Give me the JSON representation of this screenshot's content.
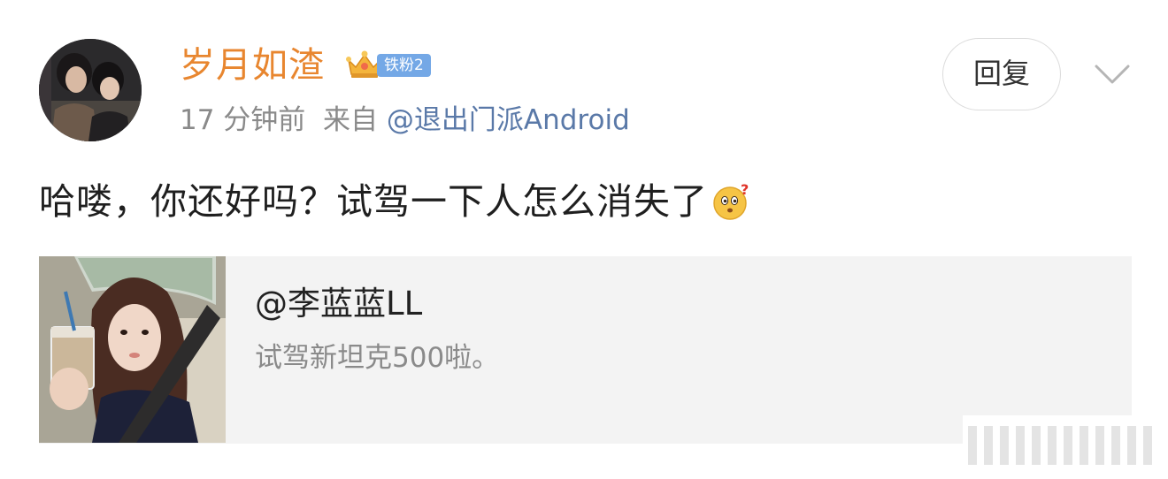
{
  "post": {
    "username": "岁月如渣",
    "fan_badge": "铁粉2",
    "time": "17 分钟前",
    "source_prefix": "来自",
    "source": "@退出门派Android",
    "reply_label": "回复",
    "comment": "哈喽，你还好吗？试驾一下人怎么消失了"
  },
  "quote": {
    "author": "@李蓝蓝LL",
    "text": "试驾新坦克500啦。"
  },
  "icons": {
    "badge": "crown-icon",
    "more": "chevron-down-icon",
    "emoji": "puzzled-face-emoji-icon"
  },
  "colors": {
    "username": "#e8862f",
    "badge": "#74a8e6",
    "link": "#5a79a8",
    "meta": "#8a8a8a",
    "card_bg": "#f3f3f3"
  }
}
